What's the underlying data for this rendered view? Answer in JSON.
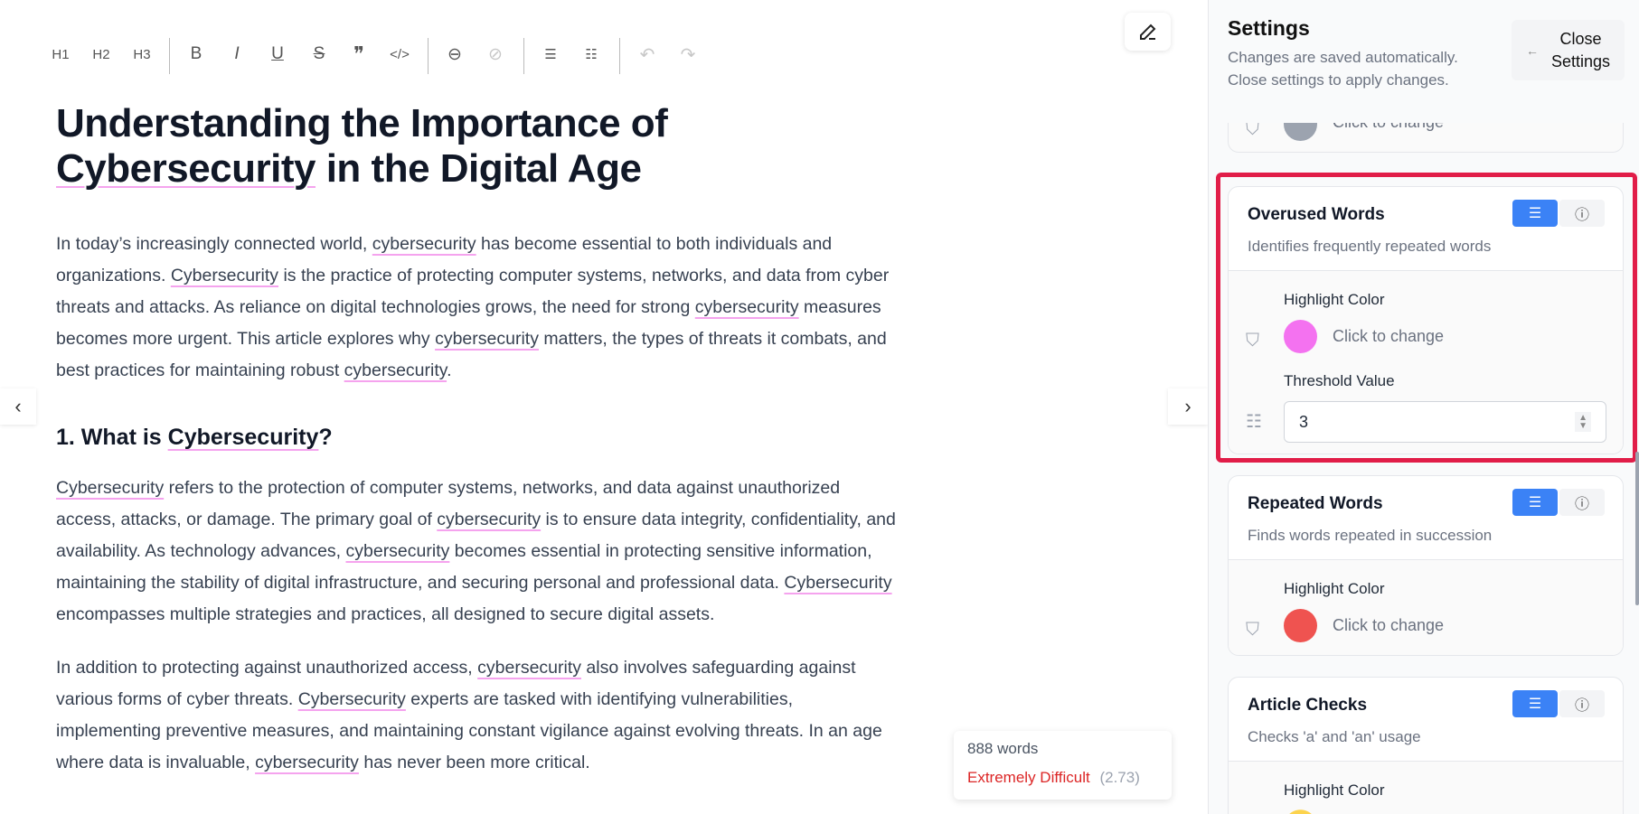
{
  "toolbar": {
    "h1": "H1",
    "h2": "H2",
    "h3": "H3",
    "bold": "B",
    "italic": "I",
    "underline": "U",
    "strike": "S",
    "quote": "❞",
    "code": "</>",
    "link": "⊖",
    "unlink": "⊘",
    "bullet": "☰",
    "ordered": "☷",
    "undo": "↶",
    "redo": "↷"
  },
  "article": {
    "title": [
      "Understanding the Importance of",
      "[Cybersecurity] in the Digital Age"
    ],
    "para1": [
      "In today’s increasingly connected world, [cybersecurity] has become essential to both individuals and",
      "organizations. [Cybersecurity] is the practice of protecting computer systems, networks, and data from cyber",
      "threats and attacks. As reliance on digital technologies grows, the need for strong [cybersecurity] measures",
      "becomes more urgent. This article explores why [cybersecurity] matters, the types of threats it combats, and",
      "best practices for maintaining robust [cybersecurity]."
    ],
    "heading": [
      "1. What is [Cybersecurity]?"
    ],
    "para2": [
      "[Cybersecurity] refers to the protection of computer systems, networks, and data against unauthorized",
      "access, attacks, or damage. The primary goal of [cybersecurity] is to ensure data integrity, confidentiality, and",
      "availability. As technology advances, [cybersecurity] becomes essential in protecting sensitive information,",
      "maintaining the stability of digital infrastructure, and securing personal and professional data. [Cybersecurity]",
      "encompasses multiple strategies and practices, all designed to secure digital assets."
    ],
    "para3": [
      "In addition to protecting against unauthorized access, [cybersecurity] also involves safeguarding against",
      "various forms of cyber threats. [Cybersecurity] experts are tasked with identifying vulnerabilities,",
      "implementing preventive measures, and maintaining constant vigilance against evolving threats. In an age",
      "where data is invaluable, [cybersecurity] has never been more critical."
    ]
  },
  "stats": {
    "words": "888 words",
    "difficulty": "Extremely Difficult",
    "score": "(2.73)",
    "difficulty_color": "#dc2626"
  },
  "settings": {
    "title": "Settings",
    "subtitle1": "Changes are saved automatically.",
    "subtitle2": "Close settings to apply changes.",
    "close1": "Close",
    "close2": "Settings",
    "prev_card": {
      "click": "Click to change",
      "color": "#9ca3af"
    },
    "overused": {
      "title": "Overused Words",
      "desc": "Identifies frequently repeated words",
      "hl_label": "Highlight Color",
      "click": "Click to change",
      "color": "#f472f0",
      "th_label": "Threshold Value",
      "threshold": "3"
    },
    "repeated": {
      "title": "Repeated Words",
      "desc": "Finds words repeated in succession",
      "hl_label": "Highlight Color",
      "click": "Click to change",
      "color": "#ef5350"
    },
    "article": {
      "title": "Article Checks",
      "desc": "Checks 'a' and 'an' usage",
      "hl_label": "Highlight Color",
      "color": "#fcd34d"
    }
  },
  "highlight_color": "#e11d48"
}
